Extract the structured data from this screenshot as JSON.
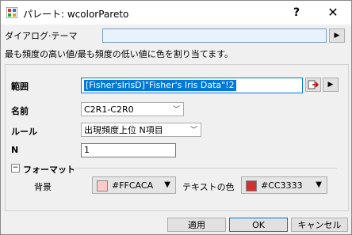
{
  "window": {
    "title": "パレート: wcolorPareto",
    "help_label": "?",
    "close_label": "✕"
  },
  "theme": {
    "label": "ダイアログ·テーマ",
    "value": "",
    "arrow_label": "▶"
  },
  "description": "最も頻度の高い値/最も頻度の低い値に色を割り当てます。",
  "range": {
    "label": "範囲",
    "value": "[Fisher'sIrisD]\"Fisher's Iris Data\"!2",
    "more_label": "▶"
  },
  "name": {
    "label": "名前",
    "value": "C2R1-C2R0"
  },
  "rule": {
    "label": "ルール",
    "value": "出現頻度上位 N項目"
  },
  "n": {
    "label": "N",
    "value": "1"
  },
  "format": {
    "section_label": "フォーマット",
    "collapse_label": "−",
    "background": {
      "label": "背景",
      "value": "#FFCACA",
      "color": "#FFCACA"
    },
    "text_color": {
      "label": "テキストの色",
      "value": "#CC3333",
      "color": "#CC3333"
    }
  },
  "buttons": {
    "apply": "適用",
    "ok": "OK",
    "cancel": "キャンセル"
  }
}
